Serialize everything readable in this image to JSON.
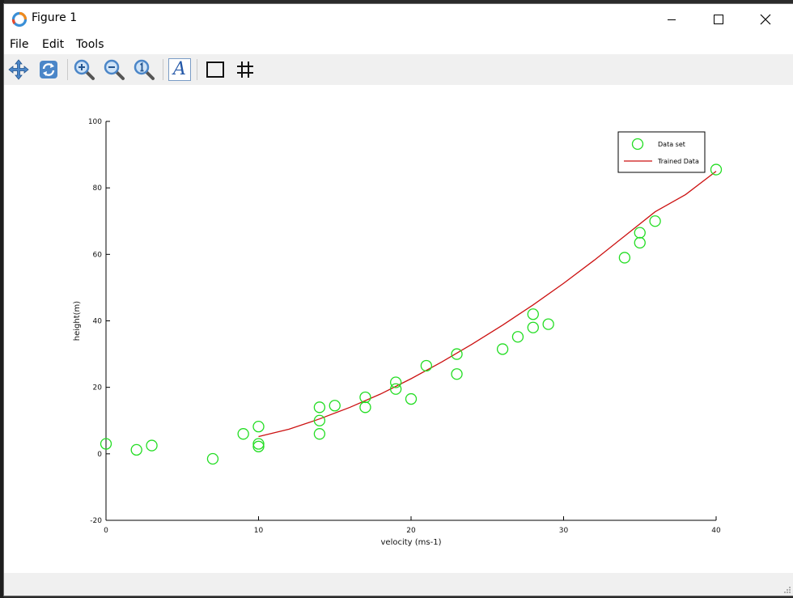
{
  "window": {
    "title": "Figure 1"
  },
  "menu": [
    "File",
    "Edit",
    "Tools"
  ],
  "toolbar": {
    "icons": [
      "pan-icon",
      "refresh-icon",
      "zoom-in-icon",
      "zoom-out-icon",
      "zoom-reset-icon",
      "text-icon",
      "box-icon",
      "grid-icon"
    ],
    "text_glyph": "A"
  },
  "colors": {
    "data": "#22dd22",
    "fit": "#cc1111"
  },
  "chart_data": {
    "type": "scatter",
    "xlabel": "velocity (ms-1)",
    "ylabel": "height(m)",
    "xlim": [
      0,
      40
    ],
    "ylim": [
      -20,
      100
    ],
    "xticks": [
      0,
      10,
      20,
      30,
      40
    ],
    "yticks": [
      -20,
      0,
      20,
      40,
      60,
      80,
      100
    ],
    "grid": false,
    "legend": "top-right",
    "series": [
      {
        "name": "Data set",
        "kind": "markers",
        "x": [
          0,
          2,
          3,
          7,
          9,
          10,
          10,
          10,
          14,
          14,
          14,
          15,
          17,
          17,
          19,
          19,
          20,
          21,
          23,
          23,
          26,
          27,
          28,
          28,
          29,
          34,
          35,
          35,
          36,
          40
        ],
        "y": [
          3,
          1.2,
          2.5,
          -1.5,
          6,
          8.2,
          3,
          2.2,
          14,
          10,
          6,
          14.5,
          17,
          14,
          21.5,
          19.5,
          16.5,
          26.5,
          30,
          24,
          31.5,
          35.2,
          42,
          38,
          39,
          59,
          63.5,
          66.5,
          70,
          85.5
        ]
      },
      {
        "name": "Trained Data",
        "kind": "line",
        "x": [
          10,
          12,
          14,
          16,
          18,
          20,
          22,
          24,
          26,
          28,
          30,
          32,
          34,
          36,
          38,
          40
        ],
        "y": [
          5.2,
          7.4,
          10.5,
          14.0,
          18.0,
          22.6,
          27.6,
          33.0,
          38.7,
          44.8,
          51.3,
          58.2,
          65.5,
          72.8,
          78.0,
          85.0
        ]
      }
    ]
  }
}
